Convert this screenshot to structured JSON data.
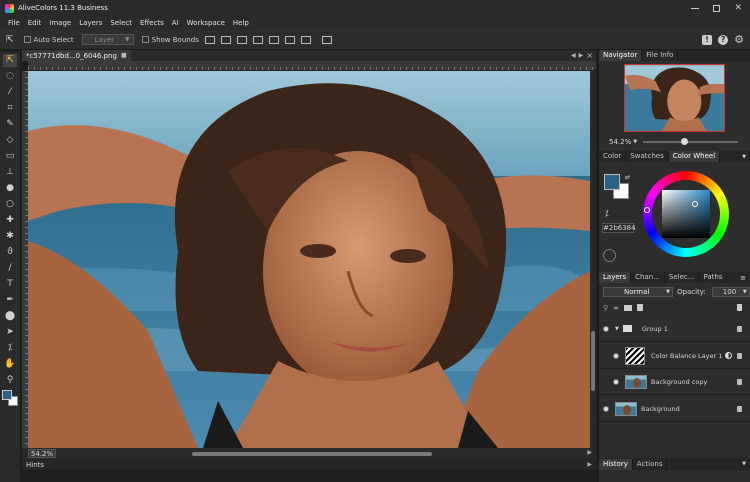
{
  "app": {
    "title": "AliveColors 11.3 Business"
  },
  "menu": [
    "File",
    "Edit",
    "Image",
    "Layers",
    "Select",
    "Effects",
    "AI",
    "Workspace",
    "Help"
  ],
  "toolbar": {
    "auto_select": "Auto Select",
    "layer_select": "Layer",
    "show_bounds": "Show Bounds"
  },
  "document": {
    "tab_title": "*c57771dbd...0_6046.png",
    "zoom": "54.2%"
  },
  "hints": {
    "label": "Hints"
  },
  "navigator": {
    "tabs": [
      "Navigator",
      "File Info"
    ],
    "zoom": "54.2%"
  },
  "color_panel": {
    "tabs": [
      "Color",
      "Swatches",
      "Color Wheel"
    ],
    "hex": "#2b6384",
    "primary_color": "#2b6384",
    "secondary_color": "#ffffff"
  },
  "layers_panel": {
    "tabs": [
      "Layers",
      "Chan...",
      "Selec...",
      "Paths"
    ],
    "blend_mode": "Normal",
    "opacity_label": "Opacity:",
    "opacity_value": "100",
    "layers": [
      {
        "name": "Group 1"
      },
      {
        "name": "Color Balance Layer 1"
      },
      {
        "name": "Background copy"
      },
      {
        "name": "Background"
      }
    ]
  },
  "history_panel": {
    "tabs": [
      "History",
      "Actions"
    ]
  },
  "colors": {
    "accent": "#2b6384",
    "background": "#1e1e1e",
    "panel": "#2d2d2d"
  }
}
